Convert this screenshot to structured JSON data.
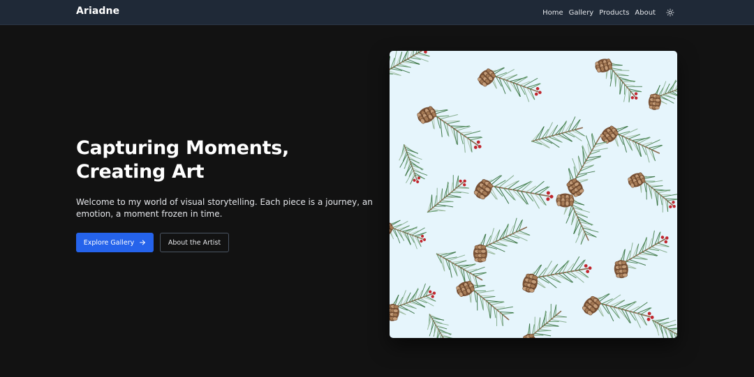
{
  "navbar": {
    "brand": "Ariadne",
    "links": [
      "Home",
      "Gallery",
      "Products",
      "About"
    ],
    "theme_toggle_icon": "sun-icon"
  },
  "hero": {
    "title_lines": [
      "Capturing Moments,",
      "Creating Art"
    ],
    "text_lines": [
      "Welcome to my world of visual storytelling. Each piece is a journey, an",
      "emotion, a moment frozen in time."
    ],
    "primary_button": {
      "label": "Explore Gallery",
      "icon": "arrow-right-icon"
    },
    "secondary_button": {
      "label": "About the Artist"
    }
  },
  "colors": {
    "page_background": "#121212",
    "navbar_background": "#1f2937",
    "accent": "#2563eb",
    "artwork_background": "#e6f5fc"
  }
}
